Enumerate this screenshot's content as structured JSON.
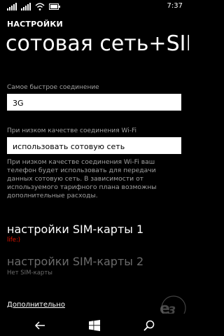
{
  "status": {
    "time": "7:37",
    "icons": [
      "signal-icon",
      "cellular-data-icon",
      "wifi-icon",
      "battery-icon"
    ]
  },
  "header": {
    "section": "НАСТРОЙКИ",
    "title": "сотовая сеть+SIM"
  },
  "connection": {
    "label": "Самое быстрое соединение",
    "value": "3G"
  },
  "wifi_fallback": {
    "label": "При низком качестве соединения Wi-Fi",
    "value": "использовать сотовую сеть",
    "info": "При низком качестве соединения Wi-Fi ваш телефон будет использовать для передачи данных сотовую сеть. В зависимости от используемого тарифного плана возможны дополнительные расходы."
  },
  "sim1": {
    "title": "настройки SIM-карты 1",
    "subtitle": "life:)",
    "subtitle_color": "#e51400"
  },
  "sim2": {
    "title": "настройки SIM-карты 2",
    "subtitle": "Нет SIM-карты",
    "disabled_color": "#6b6b6b"
  },
  "advanced": {
    "label": "Дополнительно"
  },
  "watermark": {
    "text": "3dnews"
  },
  "nav": {
    "buttons": [
      "back-icon",
      "windows-icon",
      "search-icon"
    ]
  },
  "colors": {
    "background": "#000000",
    "foreground": "#ffffff",
    "muted": "#a0a0a0"
  }
}
